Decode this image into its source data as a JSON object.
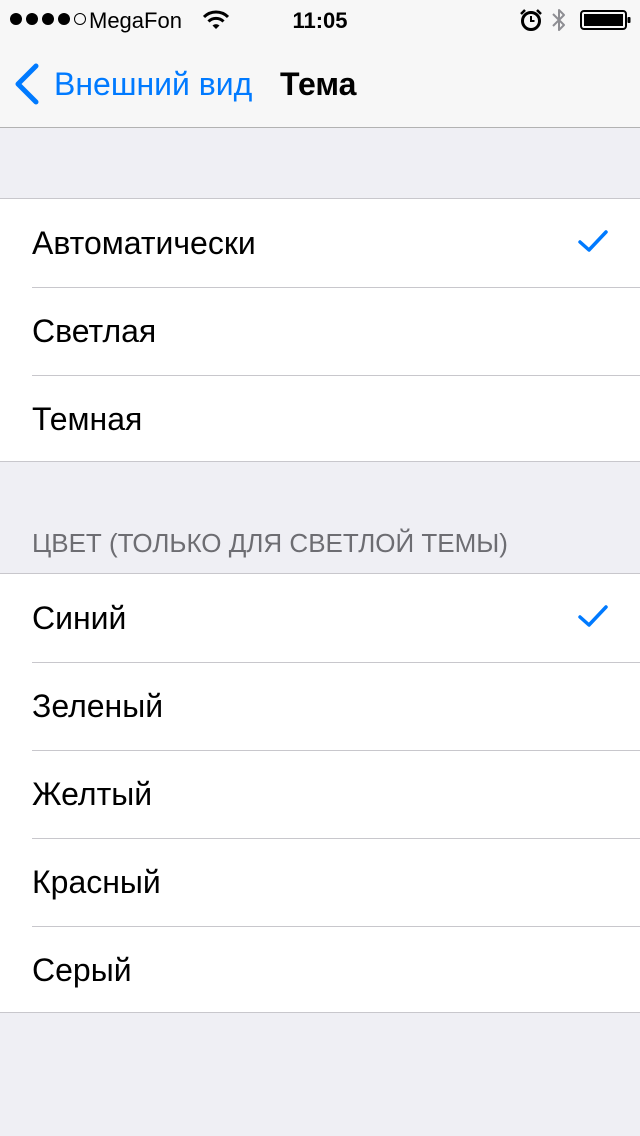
{
  "status_bar": {
    "carrier": "MegaFon",
    "time": "11:05",
    "signal_bars_filled": 4,
    "signal_bars_total": 5,
    "icons": [
      "wifi-icon",
      "alarm-icon",
      "bluetooth-icon",
      "battery-icon"
    ]
  },
  "nav": {
    "back_label": "Внешний вид",
    "title": "Тема"
  },
  "theme_options": [
    {
      "label": "Автоматически",
      "selected": true
    },
    {
      "label": "Светлая",
      "selected": false
    },
    {
      "label": "Темная",
      "selected": false
    }
  ],
  "color_section": {
    "header": "ЦВЕТ (ТОЛЬКО ДЛЯ СВЕТЛОЙ ТЕМЫ)",
    "options": [
      {
        "label": "Синий",
        "selected": true
      },
      {
        "label": "Зеленый",
        "selected": false
      },
      {
        "label": "Желтый",
        "selected": false
      },
      {
        "label": "Красный",
        "selected": false
      },
      {
        "label": "Серый",
        "selected": false
      }
    ]
  },
  "colors": {
    "accent": "#007aff",
    "background": "#efeff4",
    "separator": "#c8c7cc",
    "section_header": "#6d6d72"
  }
}
